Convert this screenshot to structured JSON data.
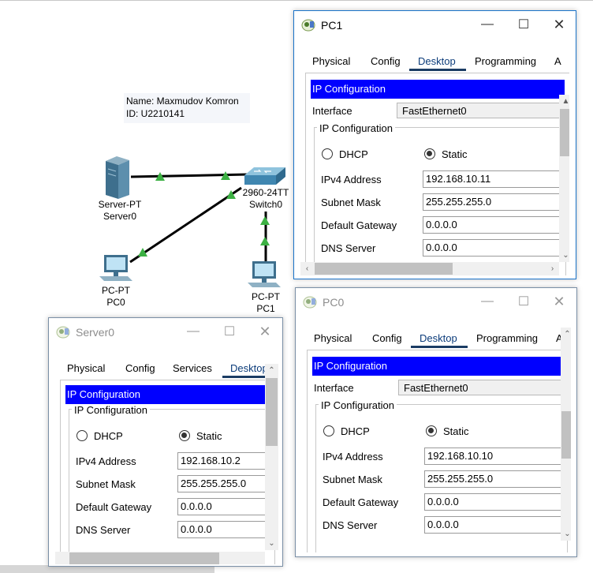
{
  "canvas": {
    "note_name": "Name: Maxmudov Komron",
    "note_id": "ID: U2210141",
    "devices": [
      {
        "type": "Server-PT",
        "name": "Server0"
      },
      {
        "type": "2960-24TT",
        "name": "Switch0"
      },
      {
        "type": "PC-PT",
        "name": "PC0"
      },
      {
        "type": "PC-PT",
        "name": "PC1"
      }
    ],
    "link_color": "#000000",
    "link_up_color": "#3cb043"
  },
  "windows": {
    "pc1": {
      "title": "PC1",
      "tabs": [
        "Physical",
        "Config",
        "Desktop",
        "Programming",
        "A"
      ],
      "selected_tab": "Desktop",
      "header": "IP Configuration",
      "interface_label": "Interface",
      "interface_value": "FastEthernet0",
      "group_title": "IP Configuration",
      "dhcp_label": "DHCP",
      "static_label": "Static",
      "mode": "Static",
      "ipv4_label": "IPv4 Address",
      "ipv4": "192.168.10.11",
      "mask_label": "Subnet Mask",
      "mask": "255.255.255.0",
      "gw_label": "Default Gateway",
      "gw": "0.0.0.0",
      "dns_label": "DNS Server",
      "dns": "0.0.0.0"
    },
    "pc0": {
      "title": "PC0",
      "tabs": [
        "Physical",
        "Config",
        "Desktop",
        "Programming",
        "A"
      ],
      "selected_tab": "Desktop",
      "header": "IP Configuration",
      "interface_label": "Interface",
      "interface_value": "FastEthernet0",
      "group_title": "IP Configuration",
      "dhcp_label": "DHCP",
      "static_label": "Static",
      "mode": "Static",
      "ipv4_label": "IPv4 Address",
      "ipv4": "192.168.10.10",
      "mask_label": "Subnet Mask",
      "mask": "255.255.255.0",
      "gw_label": "Default Gateway",
      "gw": "0.0.0.0",
      "dns_label": "DNS Server",
      "dns": "0.0.0.0"
    },
    "server0": {
      "title": "Server0",
      "tabs": [
        "Physical",
        "Config",
        "Services",
        "Desktop"
      ],
      "selected_tab": "Desktop",
      "header": "IP Configuration",
      "group_title": "IP Configuration",
      "dhcp_label": "DHCP",
      "static_label": "Static",
      "mode": "Static",
      "ipv4_label": "IPv4 Address",
      "ipv4": "192.168.10.2",
      "mask_label": "Subnet Mask",
      "mask": "255.255.255.0",
      "gw_label": "Default Gateway",
      "gw": "0.0.0.0",
      "dns_label": "DNS Server",
      "dns": "0.0.0.0"
    }
  },
  "icons": {
    "window_app": "packet-tracer-icon",
    "minimize": "minimize-icon",
    "maximize": "maximize-icon",
    "close": "close-icon"
  }
}
